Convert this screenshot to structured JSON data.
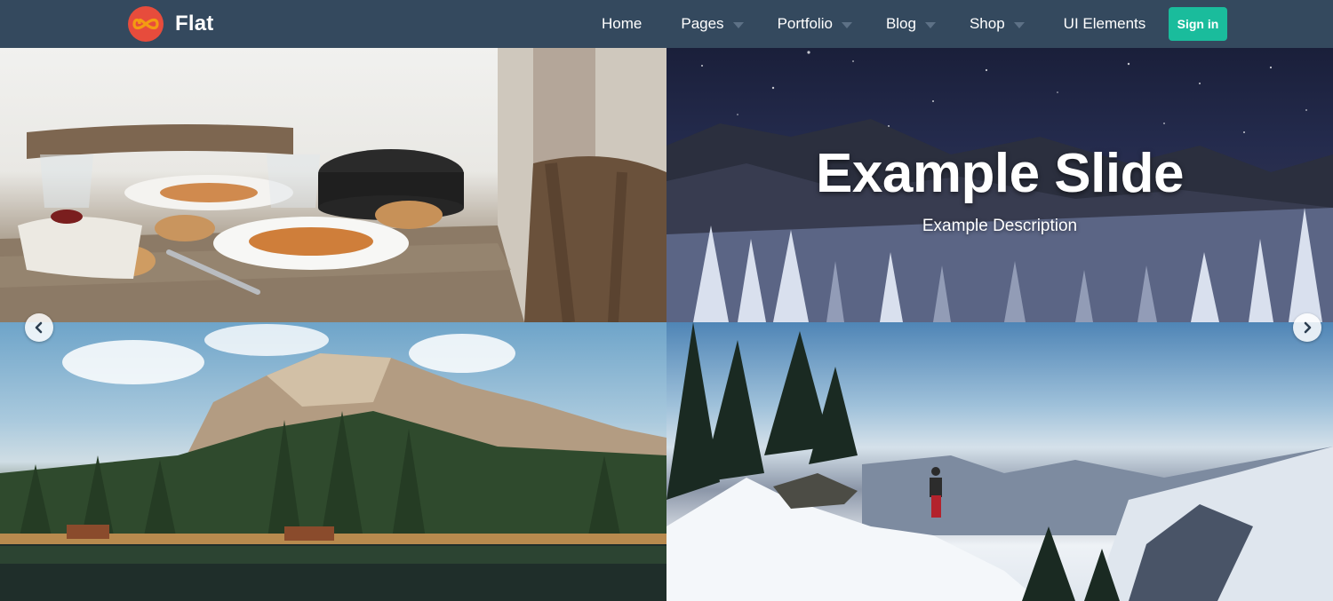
{
  "brand": {
    "name": "Flat",
    "logo_icon": "infinity-icon",
    "logo_color": "#e74c3c"
  },
  "nav": {
    "items": [
      {
        "label": "Home",
        "has_dropdown": false
      },
      {
        "label": "Pages",
        "has_dropdown": true
      },
      {
        "label": "Portfolio",
        "has_dropdown": true
      },
      {
        "label": "Blog",
        "has_dropdown": true
      },
      {
        "label": "Shop",
        "has_dropdown": true
      },
      {
        "label": "UI Elements",
        "has_dropdown": false
      }
    ],
    "signin_label": "Sign in"
  },
  "colors": {
    "navbar": "#34495e",
    "accent": "#1abc9c"
  },
  "slider": {
    "title": "Example Slide",
    "description": "Example Description",
    "prev_icon": "chevron-left-icon",
    "next_icon": "chevron-right-icon",
    "tiles": [
      "dining-table-photo",
      "starry-forest-photo",
      "mountain-lake-photo",
      "snowy-summit-photo"
    ]
  }
}
